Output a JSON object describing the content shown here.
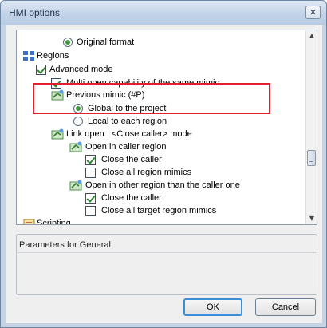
{
  "window": {
    "title": "HMI options",
    "close_glyph": "✕"
  },
  "tree": {
    "items": [
      {
        "label": "Original format",
        "control": "radio",
        "checked": true
      },
      {
        "label": "Regions",
        "control": "icon",
        "icon": "regions-icon"
      },
      {
        "label": "Advanced mode",
        "control": "checkbox",
        "checked": true
      },
      {
        "label": "Multi open capability of the same mimic",
        "control": "checkbox",
        "checked": true
      },
      {
        "label": "Previous mimic (#P)",
        "control": "icon",
        "icon": "mimic-node-icon"
      },
      {
        "label": "Global to the project",
        "control": "radio",
        "checked": true
      },
      {
        "label": "Local to each region",
        "control": "radio",
        "checked": false
      },
      {
        "label": "Link open : <Close caller> mode",
        "control": "icon",
        "icon": "mimic-node-icon"
      },
      {
        "label": "Open in caller region",
        "control": "icon",
        "icon": "mimic-node-icon"
      },
      {
        "label": "Close the caller",
        "control": "checkbox",
        "checked": true
      },
      {
        "label": "Close all region mimics",
        "control": "checkbox",
        "checked": false
      },
      {
        "label": "Open in other region than the caller one",
        "control": "icon",
        "icon": "mimic-node-icon"
      },
      {
        "label": "Close the caller",
        "control": "checkbox",
        "checked": true
      },
      {
        "label": "Close all target region mimics",
        "control": "checkbox",
        "checked": false
      },
      {
        "label": "Scripting",
        "control": "icon",
        "icon": "scripting-icon"
      }
    ]
  },
  "scrollbar": {
    "up_glyph": "▲",
    "down_glyph": "▼"
  },
  "params": {
    "title": "Parameters for General"
  },
  "buttons": {
    "ok": "OK",
    "cancel": "Cancel"
  },
  "colors": {
    "highlight": "#e0202c",
    "check_green": "#2c8a2c"
  }
}
